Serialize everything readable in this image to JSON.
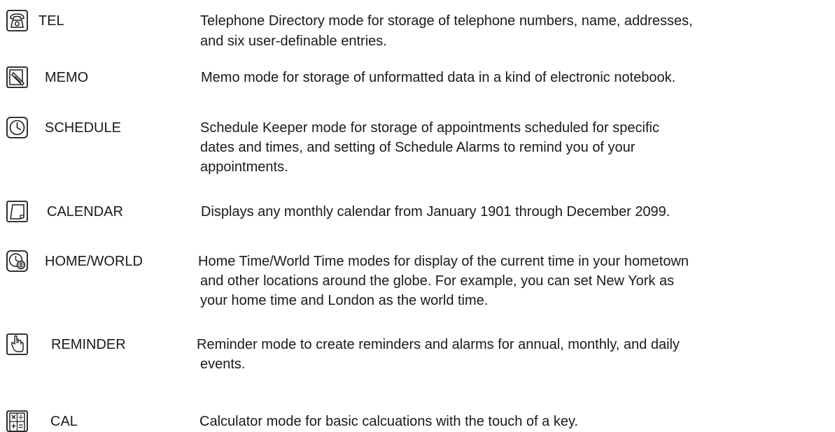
{
  "entries": [
    {
      "icon": "telephone-icon",
      "label": "TEL",
      "lines": [
        "Telephone Directory mode for storage of telephone numbers, name, addresses,",
        "and six user-definable entries."
      ]
    },
    {
      "icon": "memo-icon",
      "label": "MEMO",
      "lines": [
        "Memo mode for storage of unformatted data in a kind of electronic notebook."
      ]
    },
    {
      "icon": "clock-icon",
      "label": "SCHEDULE",
      "lines": [
        "Schedule Keeper mode for storage of appointments scheduled for specific",
        "dates and times, and setting of Schedule Alarms to remind you of your",
        "appointments."
      ]
    },
    {
      "icon": "calendar-icon",
      "label": "CALENDAR",
      "lines": [
        "Displays any monthly calendar from January 1901 through December 2099."
      ]
    },
    {
      "icon": "world-clock-icon",
      "label": "HOME/WORLD",
      "lines": [
        "Home Time/World Time modes for display of the current time in your hometown",
        "and other locations around the globe. For example, you can set New York as",
        "your home time and London as the world time."
      ]
    },
    {
      "icon": "reminder-hand-icon",
      "label": "REMINDER",
      "lines": [
        "Reminder mode to create reminders and alarms for annual, monthly, and daily",
        "events."
      ]
    },
    {
      "icon": "calculator-icon",
      "label": "CAL",
      "lines": [
        "Calculator mode for basic calcuations with the touch of a key."
      ]
    }
  ]
}
